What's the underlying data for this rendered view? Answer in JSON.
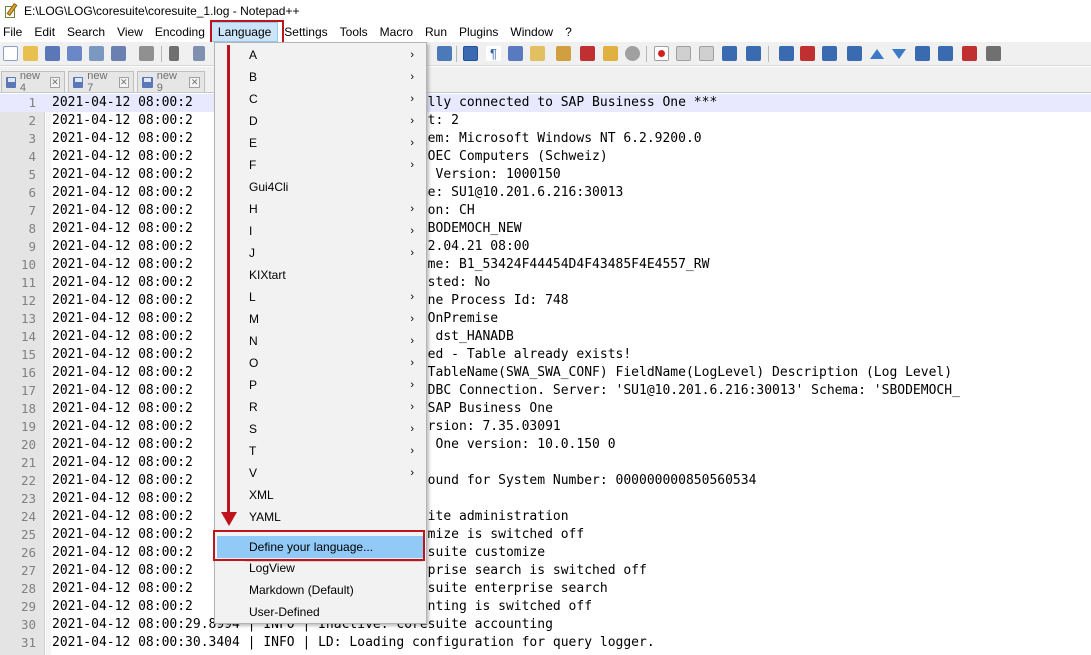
{
  "window": {
    "title": "E:\\LOG\\LOG\\coresuite\\coresuite_1.log - Notepad++"
  },
  "menubar": [
    "File",
    "Edit",
    "Search",
    "View",
    "Encoding",
    "Language",
    "Settings",
    "Tools",
    "Macro",
    "Run",
    "Plugins",
    "Window",
    "?"
  ],
  "tabs": [
    "new 4",
    "new 7",
    "new 9"
  ],
  "lines": [
    {
      "num": "1",
      "text": "2021-04-12 08:00:2                       ccessfully connected to SAP Business One ***"
    },
    {
      "num": "2",
      "text": "2021-04-12 08:00:2                       or Count: 2"
    },
    {
      "num": "3",
      "text": "2021-04-12 08:00:2                       ng System: Microsoft Windows NT 6.2.9200.0"
    },
    {
      "num": "4",
      "text": "2021-04-12 08:00:2                        Name: OEC Computers (Schweiz)"
    },
    {
      "num": "5",
      "text": "2021-04-12 08:00:2                        Object Version: 1000150"
    },
    {
      "num": "6",
      "text": "2021-04-12 08:00:2                       ver Name: SU1@10.201.6.216:30013"
    },
    {
      "num": "7",
      "text": "2021-04-12 08:00:2                       alization: CH"
    },
    {
      "num": "8",
      "text": "2021-04-12 08:00:2                       Name: SBODEMOCH_NEW"
    },
    {
      "num": "9",
      "text": "2021-04-12 08:00:2                       Date: 12.04.21 08:00"
    },
    {
      "num": "10",
      "text": "2021-04-12 08:00:2                       User Name: B1_53424F44454D4F43485F4E4557_RW"
    },
    {
      "num": "11",
      "text": "2021-04-12 08:00:2                       Use Trusted: No"
    },
    {
      "num": "12",
      "text": "2021-04-12 08:00:2                       iness One Process Id: 748"
    },
    {
      "num": "13",
      "text": "2021-04-12 08:00:2                        Mode: OnPremise"
    },
    {
      "num": "14",
      "text": "2021-04-12 08:00:2                       e Type: dst_HANADB"
    },
    {
      "num": "15",
      "text": "2021-04-12 08:00:2                       not added - Table already exists!"
    },
    {
      "num": "16",
      "text": "2021-04-12 08:00:2                       added: TableName(SWA_SWA_CONF) FieldName(LogLevel) Description (Log Level)"
    },
    {
      "num": "17",
      "text": "2021-04-12 08:00:2                       shing ODBC Connection. Server: 'SU1@10.201.6.216:30013' Schema: 'SBODEMOCH_"
    },
    {
      "num": "18",
      "text": "2021-04-12 08:00:2                       ing to SAP Business One"
    },
    {
      "num": "19",
      "text": "2021-04-12 08:00:2                       work version: 7.35.03091"
    },
    {
      "num": "20",
      "text": "2021-04-12 08:00:2                       usiness One version: 10.0.150 0"
    },
    {
      "num": "21",
      "text": "2021-04-12 08:00:2                       censes"
    },
    {
      "num": "22",
      "text": "2021-04-12 08:00:2                       e not found for System Number: 000000000850560534"
    },
    {
      "num": "23",
      "text": "2021-04-12 08:00:2                       dules"
    },
    {
      "num": "24",
      "text": "2021-04-12 08:00:2                        coresuite administration"
    },
    {
      "num": "25",
      "text": "2021-04-12 08:00:2                       e customize is switched off"
    },
    {
      "num": "26",
      "text": "2021-04-12 08:00:2                       e: coresuite customize"
    },
    {
      "num": "27",
      "text": "2021-04-12 08:00:2                       e enterprise search is switched off"
    },
    {
      "num": "28",
      "text": "2021-04-12 08:00:2                       e: coresuite enterprise search"
    },
    {
      "num": "29",
      "text": "2021-04-12 08:00:2                       e accounting is switched off"
    },
    {
      "num": "30",
      "text": "2021-04-12 08:00:29.8994 | INFO | Inactive: coresuite accounting"
    },
    {
      "num": "31",
      "text": "2021-04-12 08:00:30.3404 | INFO | LD: Loading configuration for query logger."
    }
  ],
  "language_menu": {
    "letters": [
      "A",
      "B",
      "C",
      "D",
      "E",
      "F"
    ],
    "gui4cli": "Gui4Cli",
    "letters2": [
      "H",
      "I",
      "J"
    ],
    "kixtart": "KIXtart",
    "letters3": [
      "L",
      "M",
      "N",
      "O",
      "P",
      "R",
      "S",
      "T",
      "V"
    ],
    "xml": "XML",
    "yaml": "YAML",
    "define": "Define your language...",
    "logview": "LogView",
    "markdown": "Markdown (Default)",
    "userdefined": "User-Defined",
    "submenu_arrow": "›"
  },
  "colors": {
    "highlight_red": "#c0141c",
    "menu_selected": "#91c9f7"
  }
}
